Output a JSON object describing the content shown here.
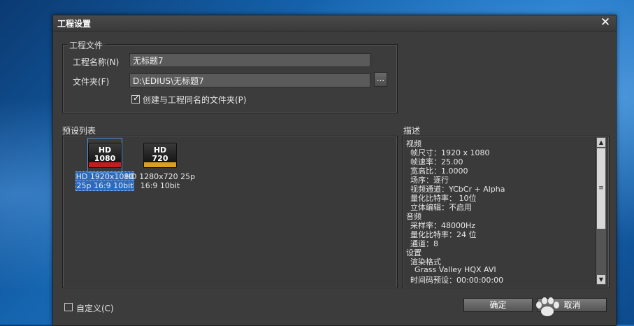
{
  "dialog": {
    "title": "工程设置"
  },
  "project_file": {
    "legend": "工程文件",
    "name_label": "工程名称(N)",
    "name_value": "无标题7",
    "folder_label": "文件夹(F)",
    "folder_value": "D:\\EDIUS\\无标题7",
    "browse_label": "...",
    "create_folder_label": "创建与工程同名的文件夹(P)",
    "create_folder_checked": true
  },
  "preset_list": {
    "label": "预设列表",
    "items": [
      {
        "icon_top": "HD",
        "icon_bottom": "1080",
        "line1": "HD 1920x1080",
        "line2": "25p 16:9 10bit",
        "selected": true
      },
      {
        "icon_top": "HD",
        "icon_bottom": "720",
        "line1": "HD 1280x720 25p",
        "line2": "16:9 10bit",
        "selected": false
      }
    ]
  },
  "description": {
    "label": "描述",
    "lines": [
      {
        "text": "视频",
        "indent": 0
      },
      {
        "text": "帧尺寸：1920 x 1080",
        "indent": 1
      },
      {
        "text": "帧速率：25.00",
        "indent": 1
      },
      {
        "text": "宽高比：1.0000",
        "indent": 1
      },
      {
        "text": "场序：逐行",
        "indent": 1
      },
      {
        "text": "视频通道：YCbCr + Alpha",
        "indent": 1
      },
      {
        "text": "量化比特率： 10位",
        "indent": 1
      },
      {
        "text": "立体编辑：不启用",
        "indent": 1
      },
      {
        "text": "音频",
        "indent": 0
      },
      {
        "text": "采样率：48000Hz",
        "indent": 1
      },
      {
        "text": "量化比特率：24 位",
        "indent": 1
      },
      {
        "text": "通道：8",
        "indent": 1
      },
      {
        "text": "设置",
        "indent": 0
      },
      {
        "text": "渲染格式",
        "indent": 1
      },
      {
        "text": "Grass Valley HQX AVI",
        "indent": 2
      },
      {
        "text": "时间码预设：00:00:00:00",
        "indent": 1
      }
    ]
  },
  "footer": {
    "custom_label": "自定义(C)",
    "custom_checked": false,
    "ok_label": "确定",
    "cancel_label": "取消"
  }
}
